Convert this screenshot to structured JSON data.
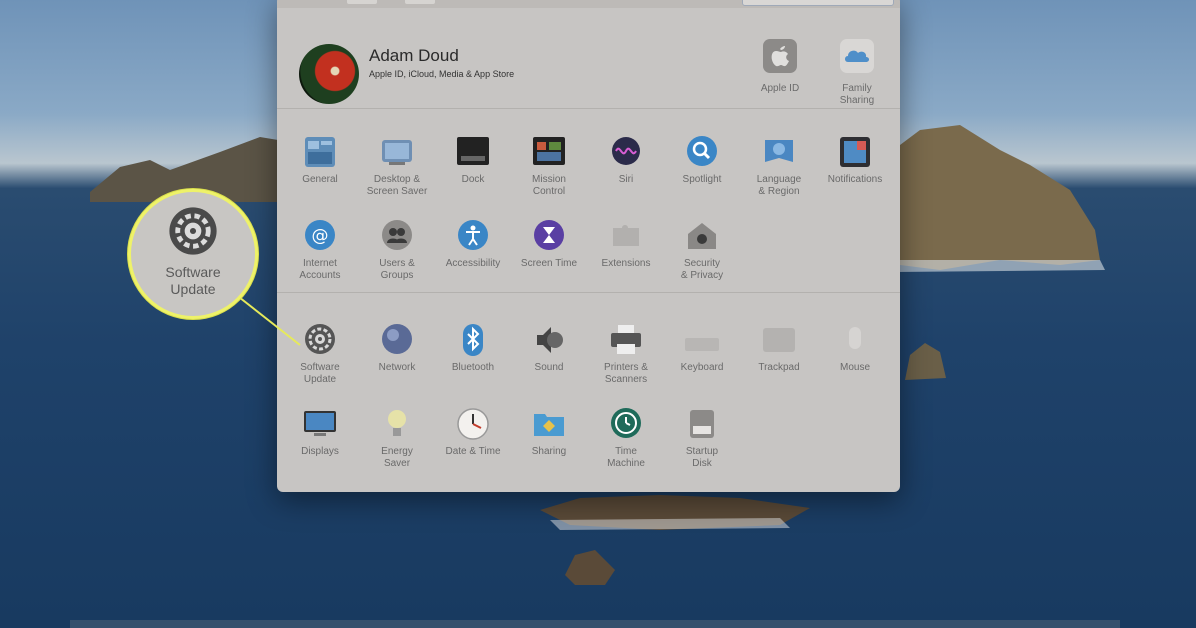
{
  "profile": {
    "name": "Adam Doud",
    "subtitle": "Apple ID, iCloud, Media & App Store",
    "apple_id_label": "Apple ID",
    "family_sharing_label": "Family\nSharing"
  },
  "prefs": {
    "row1": [
      "General",
      "Desktop &\nScreen Saver",
      "Dock",
      "Mission\nControl",
      "Siri",
      "Spotlight",
      "Language\n& Region",
      "Notifications"
    ],
    "row2": [
      "Internet\nAccounts",
      "Users &\nGroups",
      "Accessibility",
      "Screen Time",
      "Extensions",
      "Security\n& Privacy"
    ],
    "row3": [
      "Software\nUpdate",
      "Network",
      "Bluetooth",
      "Sound",
      "Printers &\nScanners",
      "Keyboard",
      "Trackpad",
      "Mouse"
    ],
    "row4": [
      "Displays",
      "Energy\nSaver",
      "Date & Time",
      "Sharing",
      "Time\nMachine",
      "Startup\nDisk"
    ]
  },
  "callout": {
    "label": "Software\nUpdate",
    "icon": "gear-icon",
    "border_color": "#eef269"
  },
  "colors": {
    "window_bg": "#c7c5c3",
    "callout_border": "#eef269"
  }
}
